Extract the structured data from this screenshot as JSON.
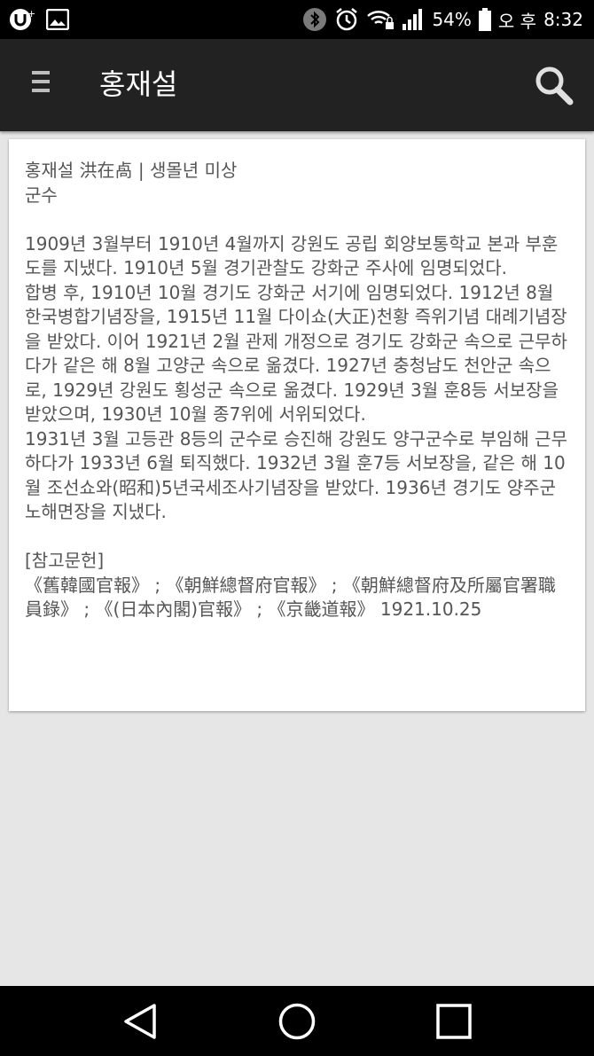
{
  "status_bar": {
    "battery": "54%",
    "ampm": "오 후",
    "time": "8:32",
    "icons": [
      "u-plus-icon",
      "gallery-icon",
      "bluetooth-icon",
      "alarm-icon",
      "wifi-lock-icon",
      "signal-icon",
      "battery-icon"
    ]
  },
  "toolbar": {
    "title": "홍재설",
    "menu_icon": "menu-icon",
    "search_icon": "search-icon"
  },
  "entry": {
    "heading": "홍재설 洪在卨 | 생몰년 미상",
    "role": "군수",
    "body": [
      "1909년 3월부터 1910년 4월까지 강원도 공립 회양보통학교 본과 부훈도를 지냈다. 1910년 5월 경기관찰도 강화군 주사에 임명되었다.",
      "합병 후, 1910년 10월 경기도 강화군 서기에 임명되었다. 1912년 8월 한국병합기념장을, 1915년 11월 다이쇼(大正)천황 즉위기념 대례기념장을 받았다. 이어 1921년 2월 관제 개정으로 경기도 강화군 속으로 근무하다가 같은 해 8월 고양군 속으로 옮겼다. 1927년 충청남도 천안군 속으로, 1929년 강원도 횡성군 속으로 옮겼다. 1929년 3월 훈8등 서보장을 받았으며, 1930년 10월 종7위에 서위되었다.",
      "1931년 3월 고등관 8등의 군수로 승진해 강원도 양구군수로 부임해 근무하다가 1933년 6월 퇴직했다. 1932년 3월 훈7등 서보장을, 같은 해 10월 조선쇼와(昭和)5년국세조사기념장을 받았다. 1936년 경기도 양주군 노해면장을 지냈다."
    ],
    "references_label": "[참고문헌]",
    "references": "《舊韓國官報》 ; 《朝鮮總督府官報》 ; 《朝鮮總督府及所屬官署職員錄》 ; 《(日本內閣)官報》 ; 《京畿道報》 1921.10.25"
  },
  "nav_bar": {
    "back_icon": "back-triangle-icon",
    "home_icon": "home-circle-icon",
    "recents_icon": "recents-square-icon"
  }
}
